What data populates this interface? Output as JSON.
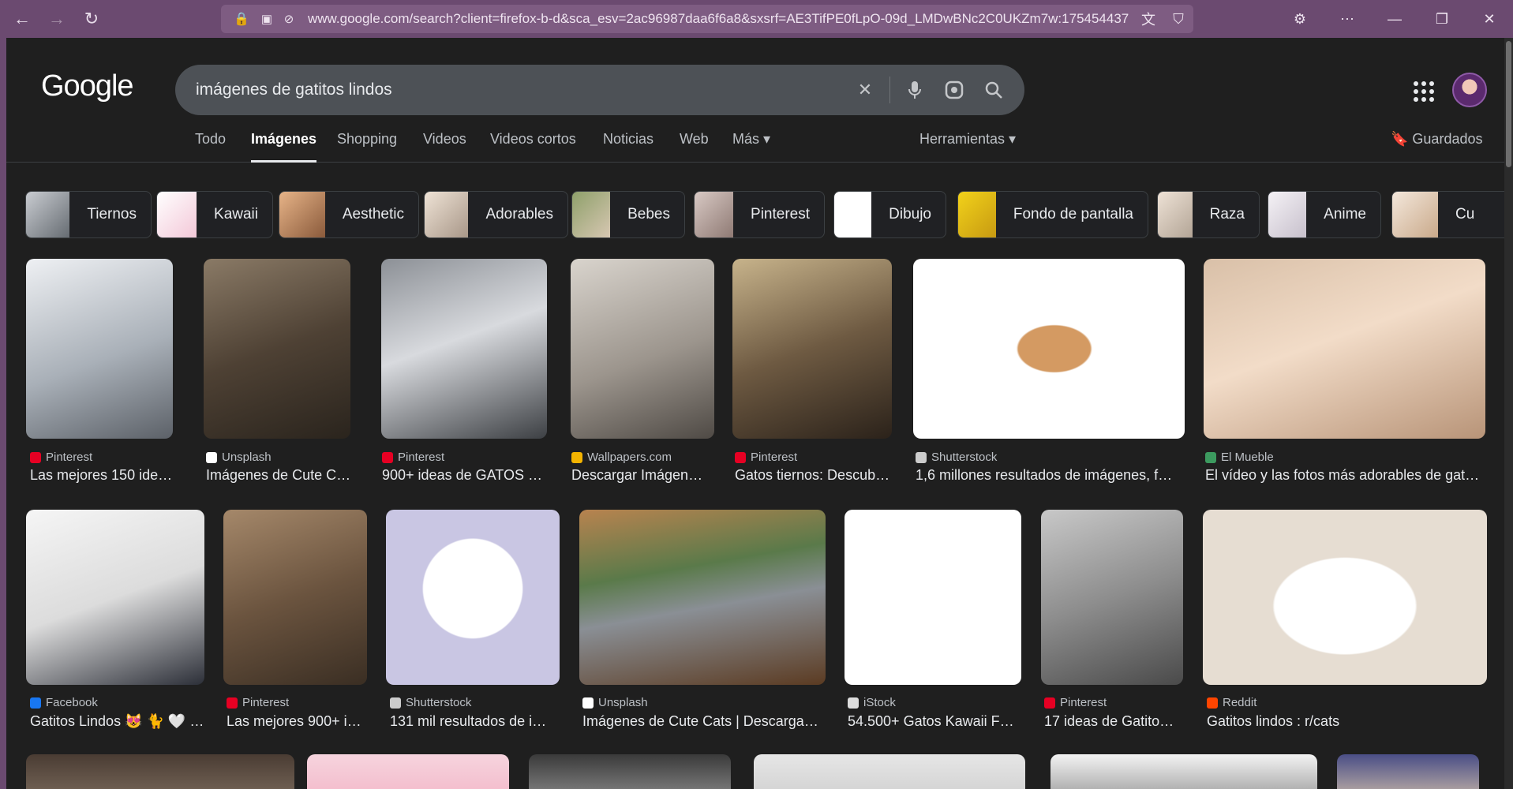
{
  "browser": {
    "url": "www.google.com/search?client=firefox-b-d&sca_esv=2ac96987daa6f6a8&sxsrf=AE3TifPE0fLpO-09d_LMDwBNc2C0UKZm7w:175454437"
  },
  "search": {
    "logo": "Google",
    "query": "imágenes de gatitos lindos"
  },
  "tabs": [
    "Todo",
    "Imágenes",
    "Shopping",
    "Videos",
    "Videos cortos",
    "Noticias",
    "Web",
    "Más ▾"
  ],
  "tools_label": "Herramientas ▾",
  "saved_label": "Guardados",
  "chips": [
    "Tiernos",
    "Kawaii",
    "Aesthetic",
    "Adorables",
    "Bebes",
    "Pinterest",
    "Dibujo",
    "Fondo de pantalla",
    "Raza",
    "Anime",
    "Cu"
  ],
  "results": [
    {
      "source": "Pinterest",
      "title": "Las mejores 150 ide…",
      "fav": "#e60023"
    },
    {
      "source": "Unsplash",
      "title": "Imágenes de Cute C…",
      "fav": "#ffffff"
    },
    {
      "source": "Pinterest",
      "title": "900+ ideas de GATOS …",
      "fav": "#e60023"
    },
    {
      "source": "Wallpapers.com",
      "title": "Descargar Imágen…",
      "fav": "#f4b400"
    },
    {
      "source": "Pinterest",
      "title": "Gatos tiernos: Descub…",
      "fav": "#e60023"
    },
    {
      "source": "Shutterstock",
      "title": "1,6 millones resultados de imágenes, f…",
      "fav": "#cccccc"
    },
    {
      "source": "El Mueble",
      "title": "El vídeo y las fotos más adorables de gat…",
      "fav": "#3c9a5f"
    },
    {
      "source": "Facebook",
      "title": "Gatitos Lindos 😻 🐈 🤍 |…",
      "fav": "#1877f2"
    },
    {
      "source": "Pinterest",
      "title": "Las mejores 900+ i…",
      "fav": "#e60023"
    },
    {
      "source": "Shutterstock",
      "title": "131 mil resultados de i…",
      "fav": "#cccccc"
    },
    {
      "source": "Unsplash",
      "title": "Imágenes de Cute Cats | Descarga…",
      "fav": "#ffffff"
    },
    {
      "source": "iStock",
      "title": "54.500+ Gatos Kawaii F…",
      "fav": "#dddddd"
    },
    {
      "source": "Pinterest",
      "title": "17 ideas de Gatito…",
      "fav": "#e60023"
    },
    {
      "source": "Reddit",
      "title": "Gatitos lindos : r/cats",
      "fav": "#ff4500"
    }
  ]
}
